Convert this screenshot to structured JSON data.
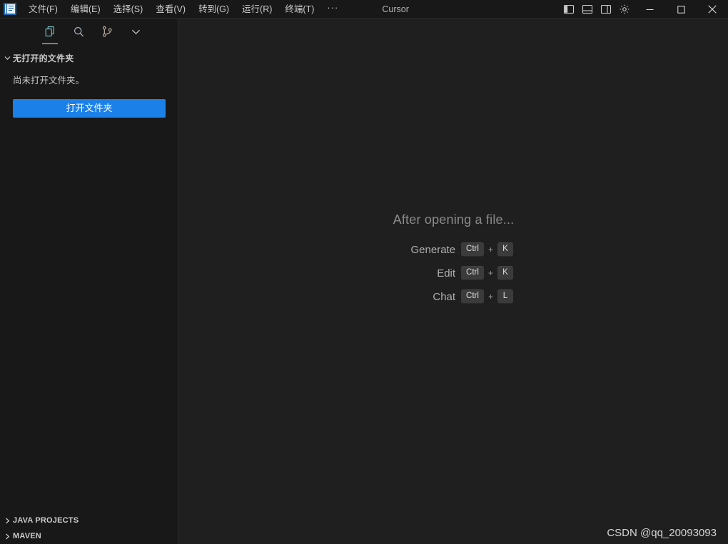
{
  "titlebar": {
    "logo_name": "cursor-app-logo",
    "menus": [
      {
        "label": "文件(F)",
        "name": "menu-file"
      },
      {
        "label": "编辑(E)",
        "name": "menu-edit"
      },
      {
        "label": "选择(S)",
        "name": "menu-selection"
      },
      {
        "label": "查看(V)",
        "name": "menu-view"
      },
      {
        "label": "转到(G)",
        "name": "menu-go"
      },
      {
        "label": "运行(R)",
        "name": "menu-run"
      },
      {
        "label": "终端(T)",
        "name": "menu-terminal"
      }
    ],
    "more_label": "···",
    "window_title": "Cursor",
    "layout_buttons": [
      {
        "name": "toggle-primary-sidebar-icon"
      },
      {
        "name": "toggle-panel-icon"
      },
      {
        "name": "toggle-secondary-sidebar-icon"
      },
      {
        "name": "gear-icon"
      }
    ],
    "window_controls": {
      "minimize": "minimize-icon",
      "maximize": "maximize-icon",
      "close": "close-icon"
    }
  },
  "sidebar": {
    "activity_icons": [
      {
        "name": "files-icon",
        "active": true
      },
      {
        "name": "search-icon",
        "active": false
      },
      {
        "name": "source-control-icon",
        "active": false
      },
      {
        "name": "chevron-down-icon",
        "active": false
      }
    ],
    "explorer": {
      "header": "无打开的文件夹",
      "message": "尚未打开文件夹。",
      "open_folder_button": "打开文件夹"
    },
    "bottom_sections": [
      {
        "label": "JAVA PROJECTS",
        "name": "section-java-projects"
      },
      {
        "label": "MAVEN",
        "name": "section-maven"
      }
    ]
  },
  "editor": {
    "welcome_title": "After opening a file...",
    "shortcuts": [
      {
        "label": "Generate",
        "keys": [
          "Ctrl",
          "K"
        ],
        "separator": "+"
      },
      {
        "label": "Edit",
        "keys": [
          "Ctrl",
          "K"
        ],
        "separator": "+"
      },
      {
        "label": "Chat",
        "keys": [
          "Ctrl",
          "L"
        ],
        "separator": "+"
      }
    ]
  },
  "watermark": "CSDN @qq_20093093",
  "colors": {
    "accent_blue": "#1b80e8",
    "titlebar_bg": "#181818",
    "sidebar_bg": "#181818",
    "editor_bg": "#1f1f1f",
    "keycap_bg": "#3b3b3b",
    "logo_blue": "#1d65ab"
  }
}
